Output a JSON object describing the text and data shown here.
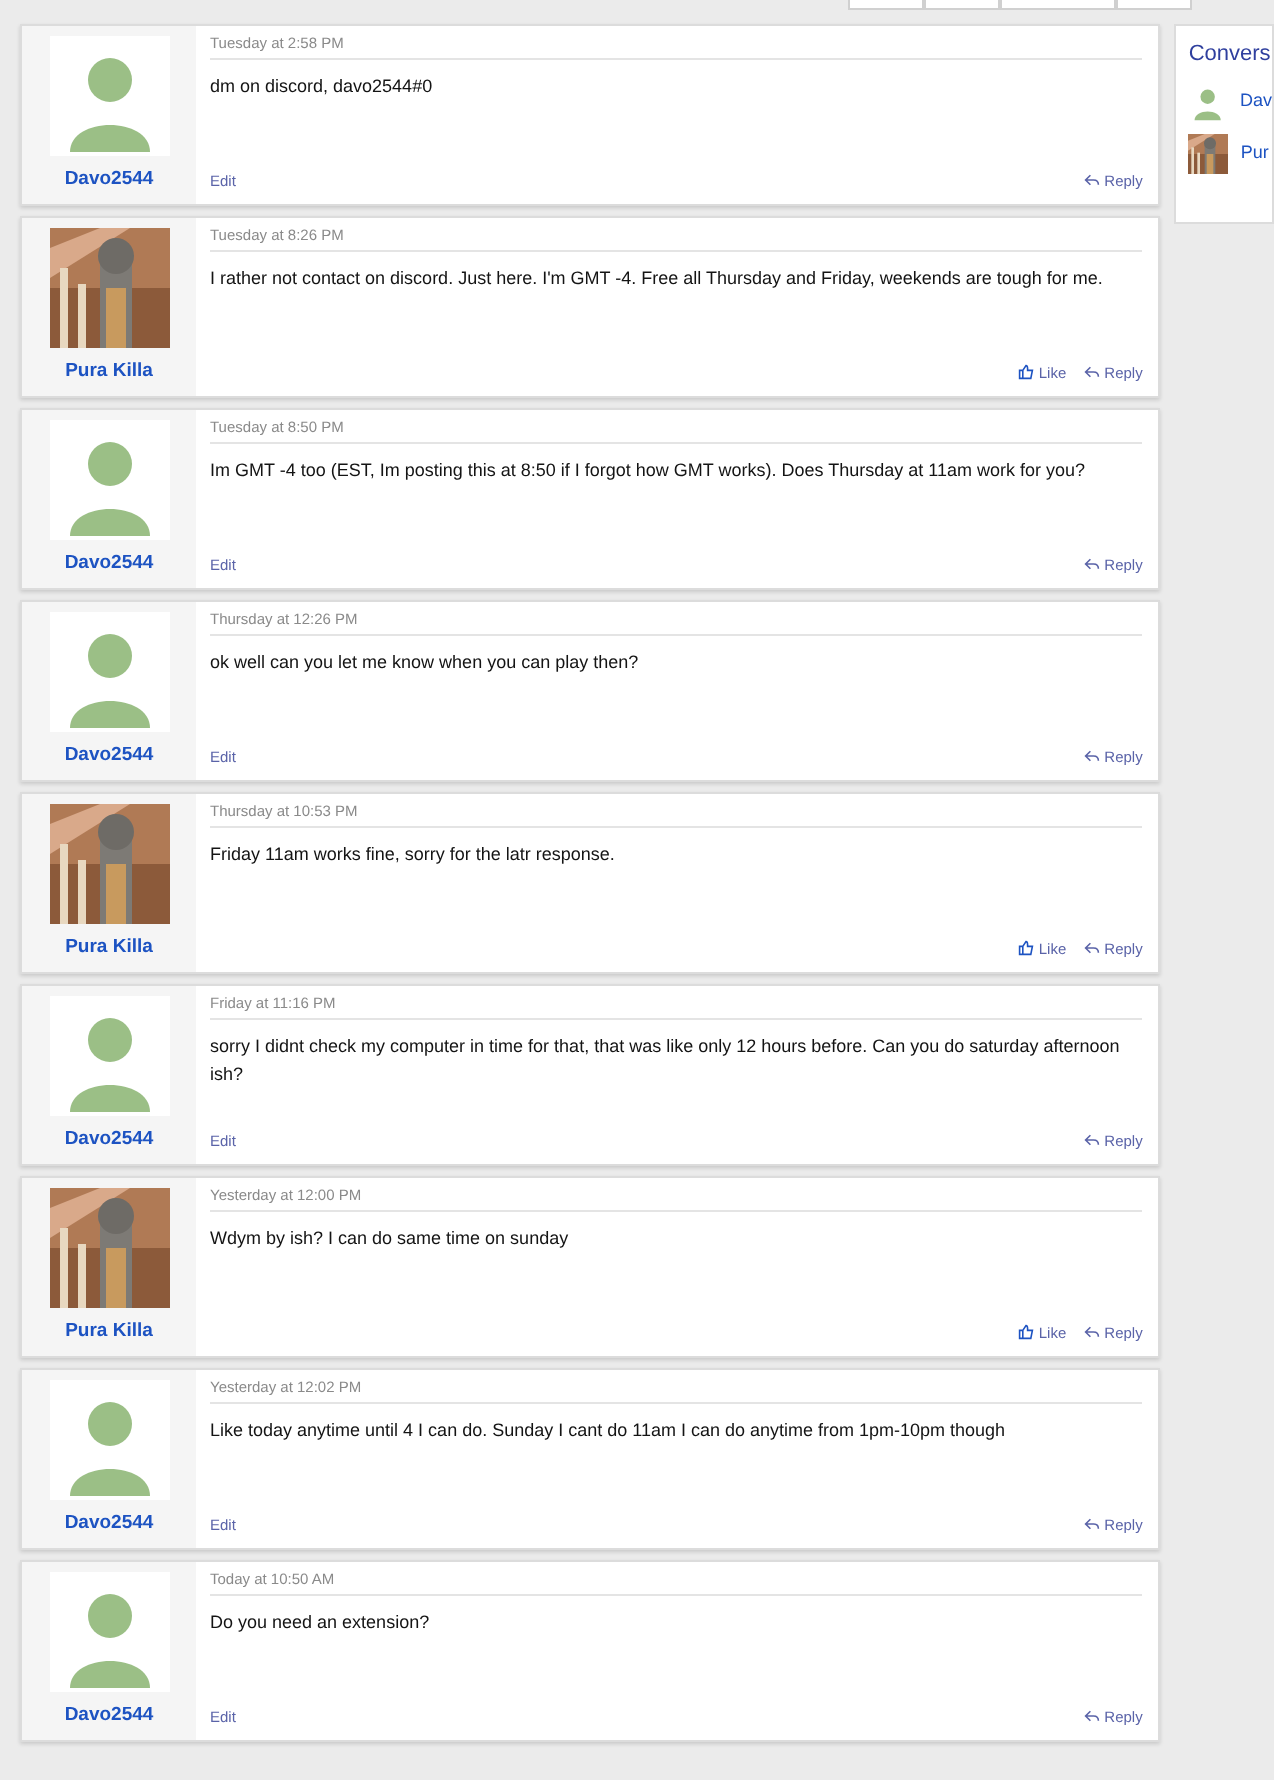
{
  "sidebar": {
    "title": "Convers",
    "participants": [
      {
        "name": "Dav",
        "avatar": {
          "kind": "silhouette"
        }
      },
      {
        "name": "Pur"
      }
    ]
  },
  "posts": [
    {
      "author": "Davo2544",
      "avatar": {
        "kind": "silhouette"
      },
      "time": "Tuesday at 2:58 PM",
      "text": "dm on discord, davo2544#0",
      "edit": "Edit",
      "reply": "Reply"
    },
    {
      "author": "Pura Killa",
      "time": "Tuesday at 8:26 PM",
      "text": "I rather not contact on discord. Just here. I'm GMT -4. Free all Thursday and Friday, weekends are tough for me.",
      "like": "Like",
      "reply": "Reply"
    },
    {
      "author": "Davo2544",
      "avatar": {
        "kind": "silhouette"
      },
      "time": "Tuesday at 8:50 PM",
      "text": "Im GMT -4 too (EST, Im posting this at 8:50 if I forgot how GMT works). Does Thursday at 11am work for you?",
      "edit": "Edit",
      "reply": "Reply"
    },
    {
      "author": "Davo2544",
      "avatar": {
        "kind": "silhouette"
      },
      "time": "Thursday at 12:26 PM",
      "text": "ok well can you let me know when you can play then?",
      "edit": "Edit",
      "reply": "Reply"
    },
    {
      "author": "Pura Killa",
      "time": "Thursday at 10:53 PM",
      "text": "Friday 11am works fine, sorry for the latr response.",
      "like": "Like",
      "reply": "Reply"
    },
    {
      "author": "Davo2544",
      "avatar": {
        "kind": "silhouette"
      },
      "time": "Friday at 11:16 PM",
      "text": "sorry I didnt check my computer in time for that, that was like only 12 hours before. Can you do saturday afternoon ish?",
      "edit": "Edit",
      "reply": "Reply"
    },
    {
      "author": "Pura Killa",
      "time": "Yesterday at 12:00 PM",
      "text": "Wdym by ish? I can do same time on sunday",
      "like": "Like",
      "reply": "Reply"
    },
    {
      "author": "Davo2544",
      "avatar": {
        "kind": "silhouette"
      },
      "time": "Yesterday at 12:02 PM",
      "text": "Like today anytime until 4 I can do. Sunday I cant do 11am I can do anytime from 1pm-10pm though",
      "edit": "Edit",
      "reply": "Reply"
    },
    {
      "author": "Davo2544",
      "avatar": {
        "kind": "silhouette"
      },
      "time": "Today at 10:50 AM",
      "text": "Do you need an extension?",
      "edit": "Edit",
      "reply": "Reply"
    }
  ]
}
